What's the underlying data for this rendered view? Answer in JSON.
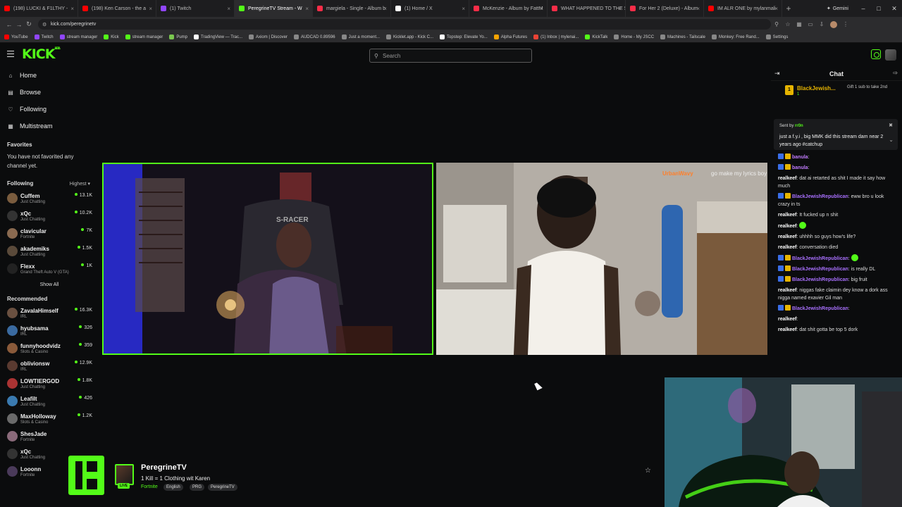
{
  "browser": {
    "tabs": [
      {
        "label": "(198) LUCKI & F1LTHY -",
        "color": "#ff0000"
      },
      {
        "label": "(198) Ken Carson - the a",
        "color": "#ff0000"
      },
      {
        "label": "(1) Twitch",
        "color": "#9146ff"
      },
      {
        "label": "PeregrineTV Stream - W",
        "color": "#53fc18"
      },
      {
        "label": "margiela - Single - Album b",
        "color": "#fa2d48"
      },
      {
        "label": "(1) Home / X",
        "color": "#ffffff"
      },
      {
        "label": "McKenzie - Album by FattM",
        "color": "#fa2d48"
      },
      {
        "label": "WHAT HAPPENED TO THE S",
        "color": "#fa2d48"
      },
      {
        "label": "For Her 2 (Deluxe) - Album",
        "color": "#fa2d48"
      },
      {
        "label": "IM ALR ONE by mylanmali",
        "color": "#ff0000"
      }
    ],
    "active_tab": 3,
    "new_tab": "+",
    "gemini": "Gemini",
    "url": "kick.com/peregrinetv",
    "bookmarks": [
      {
        "label": "YouTube",
        "color": "#ff0000"
      },
      {
        "label": "Twitch",
        "color": "#9146ff"
      },
      {
        "label": "stream manager",
        "color": "#9146ff"
      },
      {
        "label": "Kick",
        "color": "#53fc18"
      },
      {
        "label": "stream manager",
        "color": "#53fc18"
      },
      {
        "label": "Pump",
        "color": "#7ac74f"
      },
      {
        "label": "TradingView — Trac...",
        "color": "#ffffff"
      },
      {
        "label": "Axiom | Discover",
        "color": "#888888"
      },
      {
        "label": "AUDCAD 0.89596",
        "color": "#888888"
      },
      {
        "label": "Just a moment...",
        "color": "#888888"
      },
      {
        "label": "Kicklet.app - Kick C...",
        "color": "#888888"
      },
      {
        "label": "Topstep: Elevate Yo...",
        "color": "#ffffff"
      },
      {
        "label": "Alpha Futures",
        "color": "#f7a400"
      },
      {
        "label": "(1) Inbox | mylenai...",
        "color": "#ea4335"
      },
      {
        "label": "KickTalk",
        "color": "#53fc18"
      },
      {
        "label": "Home - My JSCC",
        "color": "#888888"
      },
      {
        "label": "Machines - Tailscale",
        "color": "#888888"
      },
      {
        "label": "Monkey: Free Rand...",
        "color": "#888888"
      },
      {
        "label": "Settings",
        "color": "#888888"
      }
    ]
  },
  "kick": {
    "logo": "KICK",
    "logo_beta": "BETA",
    "search_placeholder": "Search",
    "accent": "#53fc18"
  },
  "sidebar": {
    "nav": [
      {
        "label": "Home",
        "icon": "home-icon"
      },
      {
        "label": "Browse",
        "icon": "browse-icon"
      },
      {
        "label": "Following",
        "icon": "heart-icon"
      },
      {
        "label": "Multistream",
        "icon": "multistream-icon"
      }
    ],
    "favorites_title": "Favorites",
    "favorites_empty": "You have not favorited any channel yet.",
    "following_title": "Following",
    "following_sort": "Highest",
    "following": [
      {
        "name": "Cuffem",
        "category": "Just Chatting",
        "viewers": "13.1K",
        "color": "#7a5c3e"
      },
      {
        "name": "xQc",
        "category": "Just Chatting",
        "viewers": "10.2K",
        "color": "#333333"
      },
      {
        "name": "clavicular",
        "category": "Fortnite",
        "viewers": "7K",
        "color": "#8a6a50"
      },
      {
        "name": "akademiks",
        "category": "Just Chatting",
        "viewers": "1.5K",
        "color": "#5a4a3a"
      },
      {
        "name": "Flexx",
        "category": "Grand Theft Auto V (GTA)",
        "viewers": "1K",
        "color": "#222222"
      }
    ],
    "show_all": "Show All",
    "recommended_title": "Recommended",
    "recommended": [
      {
        "name": "ZavalaHimself",
        "category": "IRL",
        "viewers": "16.3K",
        "color": "#6a5040"
      },
      {
        "name": "hyubsama",
        "category": "IRL",
        "viewers": "326",
        "color": "#3a6aa0"
      },
      {
        "name": "funnyhoodvidz",
        "category": "Slots & Casino",
        "viewers": "359",
        "color": "#8a5a3a"
      },
      {
        "name": "oblivionsw",
        "category": "IRL",
        "viewers": "12.9K",
        "color": "#5a3a30"
      },
      {
        "name": "LOWTIERGOD",
        "category": "Just Chatting",
        "viewers": "1.8K",
        "color": "#aa3333"
      },
      {
        "name": "Leafilt",
        "category": "Just Chatting",
        "viewers": "426",
        "color": "#3a7ab0"
      },
      {
        "name": "MaxHolloway",
        "category": "Slots & Casino",
        "viewers": "1.2K",
        "color": "#6a6a6a"
      },
      {
        "name": "ShesJade",
        "category": "Fortnite",
        "viewers": "",
        "color": "#8a6a7a"
      },
      {
        "name": "xQc",
        "category": "Just Chatting",
        "viewers": "",
        "color": "#333333"
      },
      {
        "name": "Looonn",
        "category": "Fortnite",
        "viewers": "",
        "color": "#4a3a5a"
      }
    ]
  },
  "video": {
    "overlay_user": "UrbanWavy",
    "overlay_text": "go make my lyrics boy"
  },
  "stream": {
    "name": "PeregrineTV",
    "title": "1 Kill = 1 Clothing wit Karen",
    "category": "Fortnite",
    "tags": [
      "English",
      "PRG",
      "PeregrineTV"
    ],
    "live": "LIVE"
  },
  "chat": {
    "title": "Chat",
    "gift_user": "BlackJewish...",
    "gift_sub": "1",
    "gift_text": "Gift 1 sub to take 2nd",
    "pinned_sender_label": "Sent by",
    "pinned_sender": "rr0n",
    "pinned_message": "just a f.y.i , big MMK did this stream dam near 2 years ago #catchup",
    "messages": [
      {
        "user": "banula",
        "text": "",
        "color": "#c27cff",
        "badge": true
      },
      {
        "user": "banula",
        "text": "",
        "color": "#c27cff",
        "badge": true
      },
      {
        "user": "realkeef",
        "text": "dat ai retarted as shit I made it say how much",
        "color": "#ffffff"
      },
      {
        "user": "BlackJewishRepublican",
        "text": "eww bro u look crazy in ts",
        "color": "#a970ff",
        "badge": true
      },
      {
        "user": "realkeef",
        "text": "It fucked up n shit",
        "color": "#ffffff"
      },
      {
        "user": "realkeef",
        "text": "",
        "color": "#ffffff",
        "emote": true
      },
      {
        "user": "realkeef",
        "text": "uhhhh so guys how's life?",
        "color": "#ffffff"
      },
      {
        "user": "realkeef",
        "text": "conversation died",
        "color": "#ffffff"
      },
      {
        "user": "BlackJewishRepublican",
        "text": "",
        "color": "#a970ff",
        "badge": true,
        "emote": true
      },
      {
        "user": "BlackJewishRepublican",
        "text": "is really DL",
        "color": "#a970ff",
        "badge": true
      },
      {
        "user": "BlackJewishRepublican",
        "text": "big fruit",
        "color": "#a970ff",
        "badge": true
      },
      {
        "user": "realkeef",
        "text": "niggas fake claimin dey know a dork ass nigga named exavier Gil man",
        "color": "#ffffff"
      },
      {
        "user": "BlackJewishRepublican",
        "text": "",
        "color": "#a970ff",
        "badge": true
      },
      {
        "user": "realkeef",
        "text": "",
        "color": "#ffffff"
      },
      {
        "user": "realkeef",
        "text": "dat shit gotta be top 5 dork",
        "color": "#ffffff"
      }
    ]
  }
}
